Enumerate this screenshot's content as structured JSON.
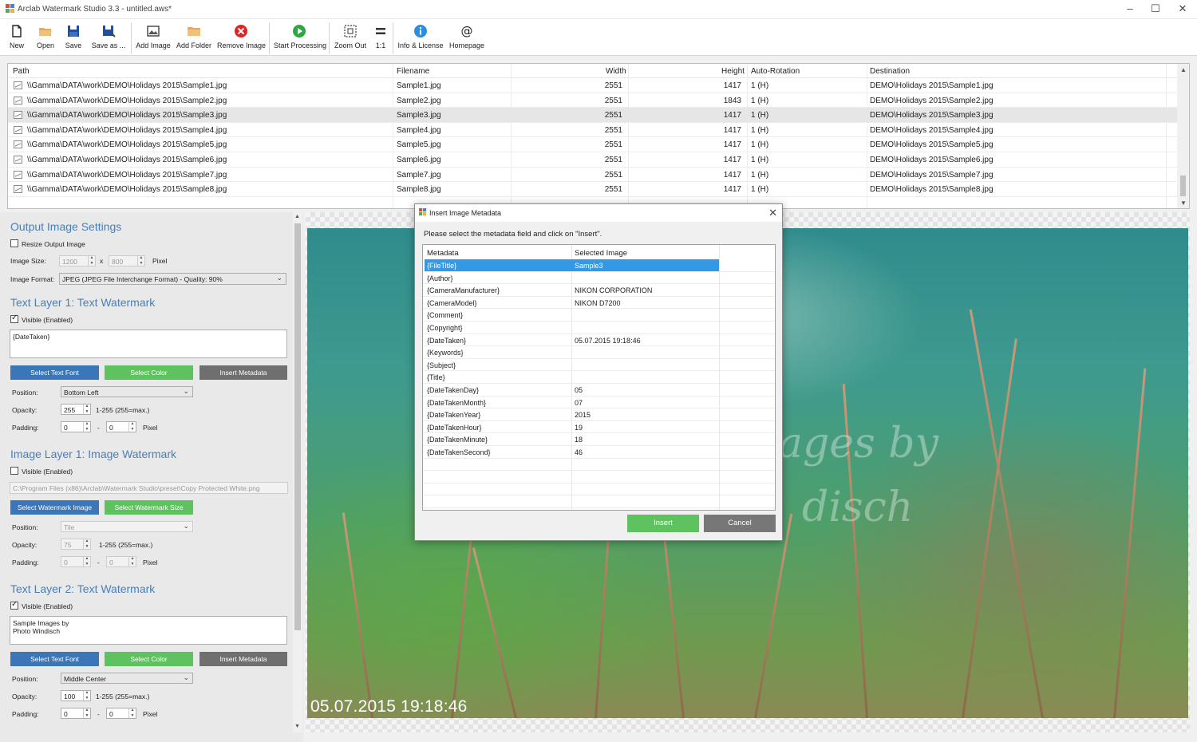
{
  "window": {
    "title": "Arclab Watermark Studio 3.3 - untitled.aws*"
  },
  "toolbar": [
    {
      "id": "new",
      "label": "New",
      "icon": "new-file-icon"
    },
    {
      "id": "open",
      "label": "Open",
      "icon": "open-folder-icon"
    },
    {
      "id": "save",
      "label": "Save",
      "icon": "save-icon"
    },
    {
      "id": "save_as",
      "label": "Save as ...",
      "icon": "save-as-icon"
    },
    {
      "id": "add_image",
      "label": "Add Image",
      "icon": "add-image-icon"
    },
    {
      "id": "add_folder",
      "label": "Add Folder",
      "icon": "add-folder-icon"
    },
    {
      "id": "remove_image",
      "label": "Remove Image",
      "icon": "remove-icon"
    },
    {
      "id": "start_processing",
      "label": "Start Processing",
      "icon": "play-icon"
    },
    {
      "id": "zoom_out",
      "label": "Zoom Out",
      "icon": "zoom-out-icon"
    },
    {
      "id": "one_to_one",
      "label": "1:1",
      "icon": "actual-size-icon"
    },
    {
      "id": "info_license",
      "label": "Info & License",
      "icon": "info-icon"
    },
    {
      "id": "homepage",
      "label": "Homepage",
      "icon": "at-icon"
    }
  ],
  "filelist": {
    "columns": {
      "path": "Path",
      "filename": "Filename",
      "width": "Width",
      "height": "Height",
      "rotation": "Auto-Rotation",
      "destination": "Destination"
    },
    "rows": [
      {
        "path": "\\\\Gamma\\DATA\\work\\DEMO\\Holidays 2015\\Sample1.jpg",
        "filename": "Sample1.jpg",
        "width": "2551",
        "height": "1417",
        "rotation": "1 (H)",
        "destination": "DEMO\\Holidays 2015\\Sample1.jpg"
      },
      {
        "path": "\\\\Gamma\\DATA\\work\\DEMO\\Holidays 2015\\Sample2.jpg",
        "filename": "Sample2.jpg",
        "width": "2551",
        "height": "1843",
        "rotation": "1 (H)",
        "destination": "DEMO\\Holidays 2015\\Sample2.jpg"
      },
      {
        "path": "\\\\Gamma\\DATA\\work\\DEMO\\Holidays 2015\\Sample3.jpg",
        "filename": "Sample3.jpg",
        "width": "2551",
        "height": "1417",
        "rotation": "1 (H)",
        "destination": "DEMO\\Holidays 2015\\Sample3.jpg",
        "selected": true
      },
      {
        "path": "\\\\Gamma\\DATA\\work\\DEMO\\Holidays 2015\\Sample4.jpg",
        "filename": "Sample4.jpg",
        "width": "2551",
        "height": "1417",
        "rotation": "1 (H)",
        "destination": "DEMO\\Holidays 2015\\Sample4.jpg"
      },
      {
        "path": "\\\\Gamma\\DATA\\work\\DEMO\\Holidays 2015\\Sample5.jpg",
        "filename": "Sample5.jpg",
        "width": "2551",
        "height": "1417",
        "rotation": "1 (H)",
        "destination": "DEMO\\Holidays 2015\\Sample5.jpg"
      },
      {
        "path": "\\\\Gamma\\DATA\\work\\DEMO\\Holidays 2015\\Sample6.jpg",
        "filename": "Sample6.jpg",
        "width": "2551",
        "height": "1417",
        "rotation": "1 (H)",
        "destination": "DEMO\\Holidays 2015\\Sample6.jpg"
      },
      {
        "path": "\\\\Gamma\\DATA\\work\\DEMO\\Holidays 2015\\Sample7.jpg",
        "filename": "Sample7.jpg",
        "width": "2551",
        "height": "1417",
        "rotation": "1 (H)",
        "destination": "DEMO\\Holidays 2015\\Sample7.jpg"
      },
      {
        "path": "\\\\Gamma\\DATA\\work\\DEMO\\Holidays 2015\\Sample8.jpg",
        "filename": "Sample8.jpg",
        "width": "2551",
        "height": "1417",
        "rotation": "1 (H)",
        "destination": "DEMO\\Holidays 2015\\Sample8.jpg"
      }
    ]
  },
  "output_settings": {
    "title": "Output Image Settings",
    "resize_label": "Resize Output Image",
    "resize_checked": false,
    "size_label": "Image Size:",
    "size_w": "1200",
    "size_x": "x",
    "size_h": "800",
    "size_unit": "Pixel",
    "format_label": "Image Format:",
    "format_value": "JPEG (JPEG File Interchange Format) - Quality: 90%"
  },
  "text_layer_1": {
    "title": "Text Layer 1: Text Watermark",
    "visible_label": "Visible (Enabled)",
    "visible_checked": true,
    "text": "{DateTaken}",
    "btn_font": "Select Text Font",
    "btn_color": "Select Color",
    "btn_metadata": "Insert Metadata",
    "position_label": "Position:",
    "position_value": "Bottom Left",
    "opacity_label": "Opacity:",
    "opacity_value": "255",
    "opacity_hint": "1-255 (255=max.)",
    "padding_label": "Padding:",
    "padding_a": "0",
    "padding_dash": "-",
    "padding_b": "0",
    "padding_unit": "Pixel"
  },
  "image_layer_1": {
    "title": "Image Layer 1: Image Watermark",
    "visible_label": "Visible (Enabled)",
    "visible_checked": false,
    "path": "C:\\Program Files (x86)\\Arclab\\Watermark Studio\\preset\\Copy Protected White.png",
    "btn_image": "Select Watermark Image",
    "btn_size": "Select Watermark Size",
    "position_label": "Position:",
    "position_value": "Tile",
    "opacity_label": "Opacity:",
    "opacity_value": "75",
    "opacity_hint": "1-255 (255=max.)",
    "padding_label": "Padding:",
    "padding_a": "0",
    "padding_dash": "-",
    "padding_b": "0",
    "padding_unit": "Pixel"
  },
  "text_layer_2": {
    "title": "Text Layer 2: Text Watermark",
    "visible_label": "Visible (Enabled)",
    "visible_checked": true,
    "text": "Sample Images by\nPhoto Windisch",
    "btn_font": "Select Text Font",
    "btn_color": "Select Color",
    "btn_metadata": "Insert Metadata",
    "position_label": "Position:",
    "position_value": "Middle Center",
    "opacity_label": "Opacity:",
    "opacity_value": "100",
    "opacity_hint": "1-255 (255=max.)",
    "padding_label": "Padding:",
    "padding_a": "0",
    "padding_dash": "-",
    "padding_b": "0",
    "padding_unit": "Pixel"
  },
  "preview": {
    "watermark_line1": "ages by",
    "watermark_line2": "disch",
    "date_text": "05.07.2015 19:18:46"
  },
  "dialog": {
    "title": "Insert Image Metadata",
    "prompt": "Please select the metadata field and click on \"Insert\".",
    "col_metadata": "Metadata",
    "col_selected": "Selected Image",
    "rows": [
      {
        "field": "{FileTitle}",
        "value": "Sample3",
        "selected": true
      },
      {
        "field": "{Author}",
        "value": ""
      },
      {
        "field": "{CameraManufacturer}",
        "value": "NIKON CORPORATION"
      },
      {
        "field": "{CameraModel}",
        "value": "NIKON D7200"
      },
      {
        "field": "{Comment}",
        "value": ""
      },
      {
        "field": "{Copyright}",
        "value": ""
      },
      {
        "field": "{DateTaken}",
        "value": "05.07.2015 19:18:46"
      },
      {
        "field": "{Keywords}",
        "value": ""
      },
      {
        "field": "{Subject}",
        "value": ""
      },
      {
        "field": "{Title}",
        "value": ""
      },
      {
        "field": "{DateTakenDay}",
        "value": "05"
      },
      {
        "field": "{DateTakenMonth}",
        "value": "07"
      },
      {
        "field": "{DateTakenYear}",
        "value": "2015"
      },
      {
        "field": "{DateTakenHour}",
        "value": "19"
      },
      {
        "field": "{DateTakenMinute}",
        "value": "18"
      },
      {
        "field": "{DateTakenSecond}",
        "value": "46"
      }
    ],
    "btn_insert": "Insert",
    "btn_cancel": "Cancel"
  },
  "colors": {
    "accent_blue": "#3a76b8",
    "accent_green": "#5ec35e",
    "section_title": "#4a7fb5",
    "selection": "#3399e6"
  }
}
